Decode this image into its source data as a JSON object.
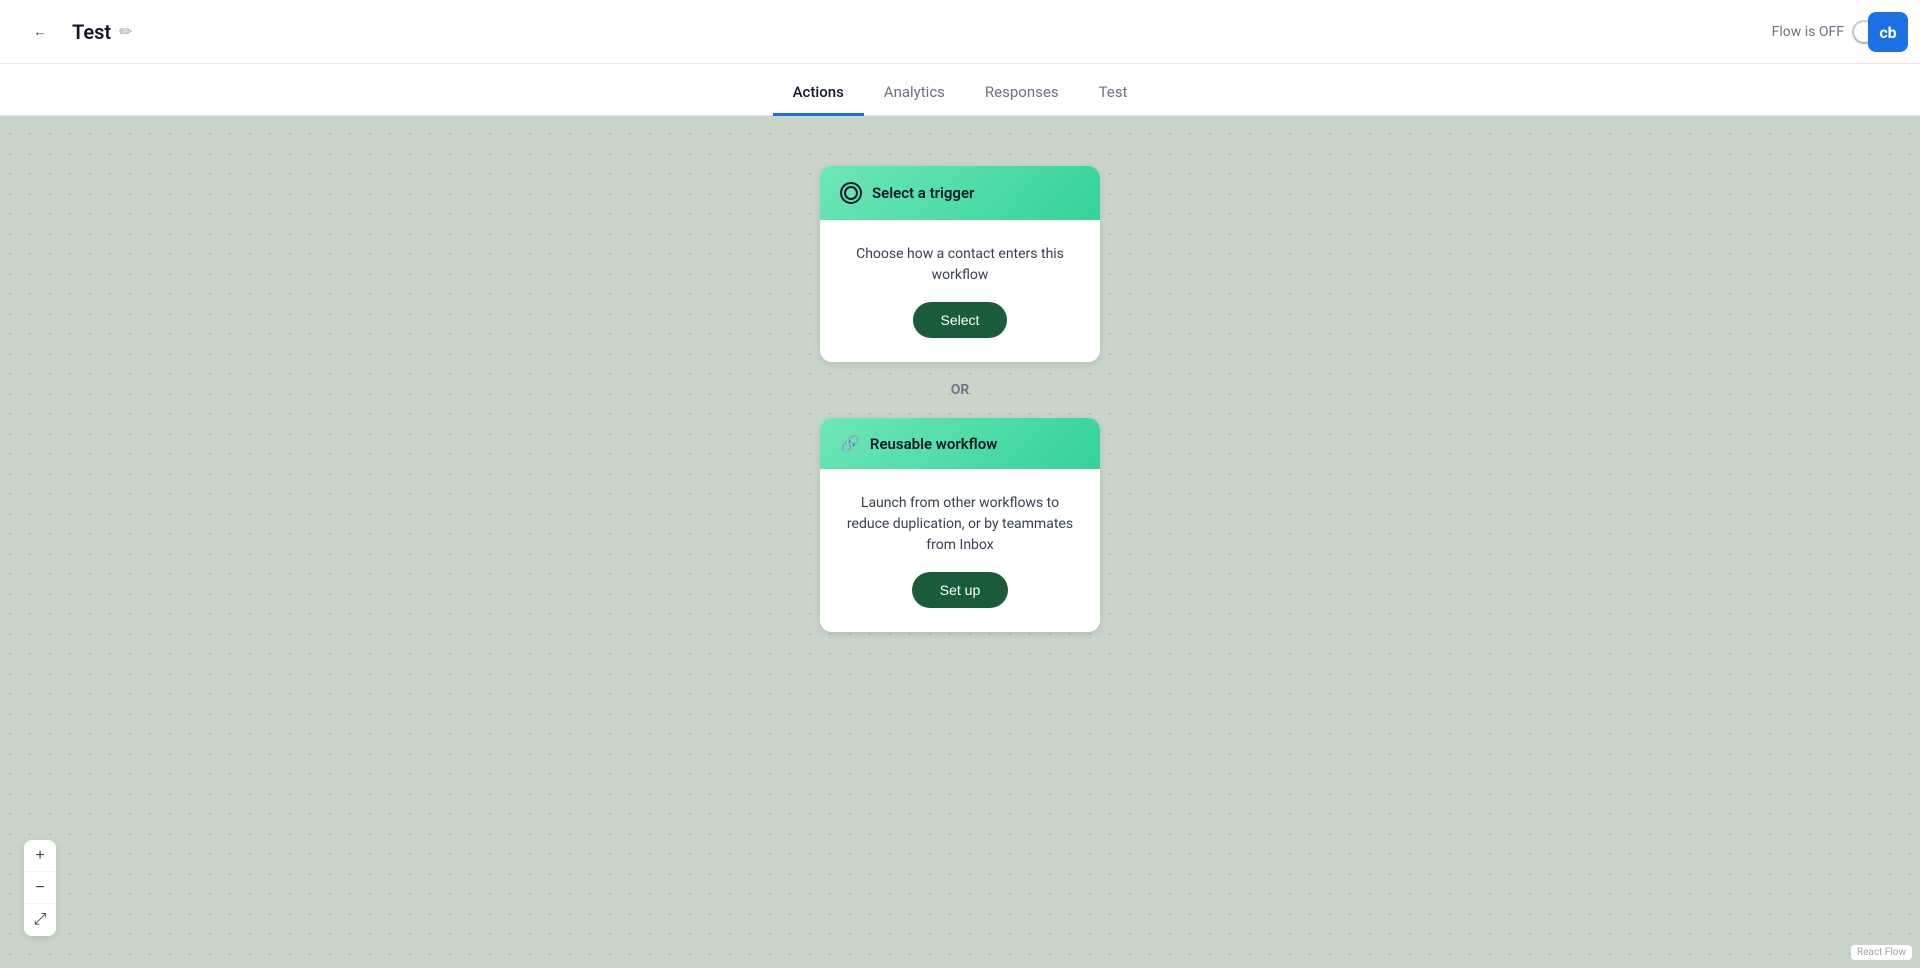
{
  "header": {
    "title": "Test",
    "back_label": "←",
    "edit_icon": "✏",
    "flow_status_label": "Flow is OFF"
  },
  "avatar": {
    "initials": "cb"
  },
  "nav": {
    "tabs": [
      {
        "id": "actions",
        "label": "Actions",
        "active": true
      },
      {
        "id": "analytics",
        "label": "Analytics",
        "active": false
      },
      {
        "id": "responses",
        "label": "Responses",
        "active": false
      },
      {
        "id": "test",
        "label": "Test",
        "active": false
      }
    ]
  },
  "trigger_card": {
    "header_label": "Select a trigger",
    "description": "Choose how a contact enters this workflow",
    "button_label": "Select"
  },
  "or_divider": "OR",
  "reusable_card": {
    "header_label": "Reusable workflow",
    "description": "Launch from other workflows to reduce duplication, or by teammates from Inbox",
    "button_label": "Set up"
  },
  "zoom_controls": {
    "zoom_in_label": "+",
    "zoom_out_label": "−",
    "fit_label": "⤢"
  },
  "react_flow_label": "React Flow"
}
